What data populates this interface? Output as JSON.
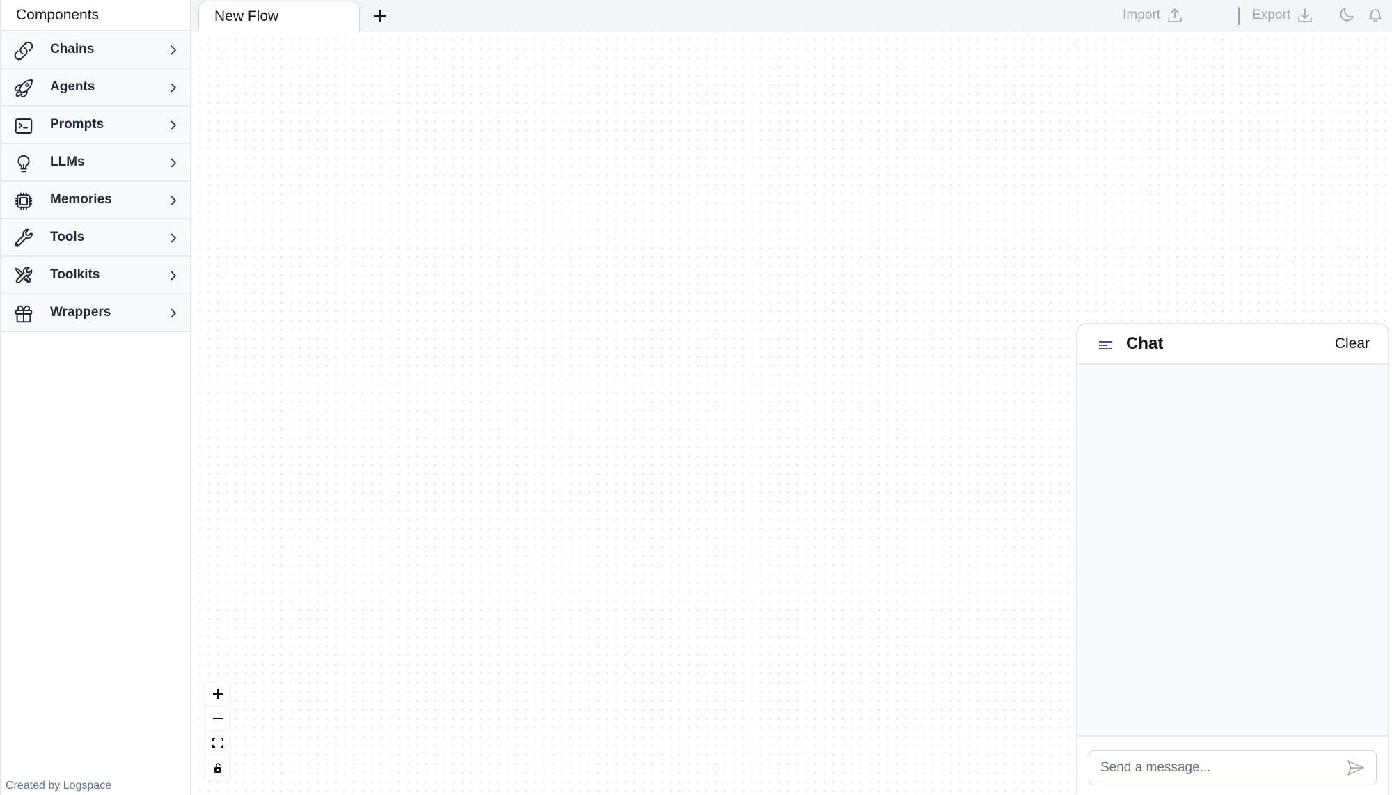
{
  "sidebar": {
    "title": "Components",
    "items": [
      {
        "label": "Chains",
        "icon": "link-icon"
      },
      {
        "label": "Agents",
        "icon": "rocket-icon"
      },
      {
        "label": "Prompts",
        "icon": "terminal-icon"
      },
      {
        "label": "LLMs",
        "icon": "lightbulb-icon"
      },
      {
        "label": "Memories",
        "icon": "cpu-chip-icon"
      },
      {
        "label": "Tools",
        "icon": "wrench-icon"
      },
      {
        "label": "Toolkits",
        "icon": "wrench-screwdriver-icon"
      },
      {
        "label": "Wrappers",
        "icon": "gift-icon"
      }
    ],
    "footer": "Created by Logspace"
  },
  "topbar": {
    "tabs": [
      {
        "label": "New Flow",
        "active": true
      }
    ],
    "add_tab_icon": "plus-icon",
    "import_label": "Import",
    "export_label": "Export",
    "theme_icon": "moon-icon",
    "notifications_icon": "bell-icon"
  },
  "canvas": {
    "controls": [
      {
        "name": "zoom-in",
        "icon": "plus-icon"
      },
      {
        "name": "zoom-out",
        "icon": "minus-icon"
      },
      {
        "name": "fit-view",
        "icon": "fit-view-icon"
      },
      {
        "name": "toggle-lock",
        "icon": "unlock-icon"
      }
    ]
  },
  "chat": {
    "title": "Chat",
    "clear_label": "Clear",
    "input": {
      "value": "",
      "placeholder": "Send a message..."
    },
    "messages": []
  },
  "colors": {
    "sidebar_item_bg": "#f9fafb",
    "border": "#e5e7eb",
    "muted_text": "#9ca3af",
    "menu_icon": "#4b4f7a"
  }
}
